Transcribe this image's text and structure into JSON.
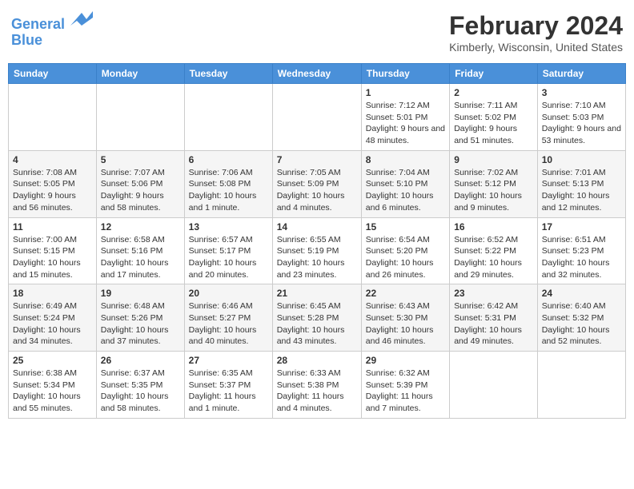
{
  "header": {
    "logo_line1": "General",
    "logo_line2": "Blue",
    "month": "February 2024",
    "location": "Kimberly, Wisconsin, United States"
  },
  "days_of_week": [
    "Sunday",
    "Monday",
    "Tuesday",
    "Wednesday",
    "Thursday",
    "Friday",
    "Saturday"
  ],
  "weeks": [
    [
      {
        "day": "",
        "data": ""
      },
      {
        "day": "",
        "data": ""
      },
      {
        "day": "",
        "data": ""
      },
      {
        "day": "",
        "data": ""
      },
      {
        "day": "1",
        "data": "Sunrise: 7:12 AM\nSunset: 5:01 PM\nDaylight: 9 hours and 48 minutes."
      },
      {
        "day": "2",
        "data": "Sunrise: 7:11 AM\nSunset: 5:02 PM\nDaylight: 9 hours and 51 minutes."
      },
      {
        "day": "3",
        "data": "Sunrise: 7:10 AM\nSunset: 5:03 PM\nDaylight: 9 hours and 53 minutes."
      }
    ],
    [
      {
        "day": "4",
        "data": "Sunrise: 7:08 AM\nSunset: 5:05 PM\nDaylight: 9 hours and 56 minutes."
      },
      {
        "day": "5",
        "data": "Sunrise: 7:07 AM\nSunset: 5:06 PM\nDaylight: 9 hours and 58 minutes."
      },
      {
        "day": "6",
        "data": "Sunrise: 7:06 AM\nSunset: 5:08 PM\nDaylight: 10 hours and 1 minute."
      },
      {
        "day": "7",
        "data": "Sunrise: 7:05 AM\nSunset: 5:09 PM\nDaylight: 10 hours and 4 minutes."
      },
      {
        "day": "8",
        "data": "Sunrise: 7:04 AM\nSunset: 5:10 PM\nDaylight: 10 hours and 6 minutes."
      },
      {
        "day": "9",
        "data": "Sunrise: 7:02 AM\nSunset: 5:12 PM\nDaylight: 10 hours and 9 minutes."
      },
      {
        "day": "10",
        "data": "Sunrise: 7:01 AM\nSunset: 5:13 PM\nDaylight: 10 hours and 12 minutes."
      }
    ],
    [
      {
        "day": "11",
        "data": "Sunrise: 7:00 AM\nSunset: 5:15 PM\nDaylight: 10 hours and 15 minutes."
      },
      {
        "day": "12",
        "data": "Sunrise: 6:58 AM\nSunset: 5:16 PM\nDaylight: 10 hours and 17 minutes."
      },
      {
        "day": "13",
        "data": "Sunrise: 6:57 AM\nSunset: 5:17 PM\nDaylight: 10 hours and 20 minutes."
      },
      {
        "day": "14",
        "data": "Sunrise: 6:55 AM\nSunset: 5:19 PM\nDaylight: 10 hours and 23 minutes."
      },
      {
        "day": "15",
        "data": "Sunrise: 6:54 AM\nSunset: 5:20 PM\nDaylight: 10 hours and 26 minutes."
      },
      {
        "day": "16",
        "data": "Sunrise: 6:52 AM\nSunset: 5:22 PM\nDaylight: 10 hours and 29 minutes."
      },
      {
        "day": "17",
        "data": "Sunrise: 6:51 AM\nSunset: 5:23 PM\nDaylight: 10 hours and 32 minutes."
      }
    ],
    [
      {
        "day": "18",
        "data": "Sunrise: 6:49 AM\nSunset: 5:24 PM\nDaylight: 10 hours and 34 minutes."
      },
      {
        "day": "19",
        "data": "Sunrise: 6:48 AM\nSunset: 5:26 PM\nDaylight: 10 hours and 37 minutes."
      },
      {
        "day": "20",
        "data": "Sunrise: 6:46 AM\nSunset: 5:27 PM\nDaylight: 10 hours and 40 minutes."
      },
      {
        "day": "21",
        "data": "Sunrise: 6:45 AM\nSunset: 5:28 PM\nDaylight: 10 hours and 43 minutes."
      },
      {
        "day": "22",
        "data": "Sunrise: 6:43 AM\nSunset: 5:30 PM\nDaylight: 10 hours and 46 minutes."
      },
      {
        "day": "23",
        "data": "Sunrise: 6:42 AM\nSunset: 5:31 PM\nDaylight: 10 hours and 49 minutes."
      },
      {
        "day": "24",
        "data": "Sunrise: 6:40 AM\nSunset: 5:32 PM\nDaylight: 10 hours and 52 minutes."
      }
    ],
    [
      {
        "day": "25",
        "data": "Sunrise: 6:38 AM\nSunset: 5:34 PM\nDaylight: 10 hours and 55 minutes."
      },
      {
        "day": "26",
        "data": "Sunrise: 6:37 AM\nSunset: 5:35 PM\nDaylight: 10 hours and 58 minutes."
      },
      {
        "day": "27",
        "data": "Sunrise: 6:35 AM\nSunset: 5:37 PM\nDaylight: 11 hours and 1 minute."
      },
      {
        "day": "28",
        "data": "Sunrise: 6:33 AM\nSunset: 5:38 PM\nDaylight: 11 hours and 4 minutes."
      },
      {
        "day": "29",
        "data": "Sunrise: 6:32 AM\nSunset: 5:39 PM\nDaylight: 11 hours and 7 minutes."
      },
      {
        "day": "",
        "data": ""
      },
      {
        "day": "",
        "data": ""
      }
    ]
  ]
}
